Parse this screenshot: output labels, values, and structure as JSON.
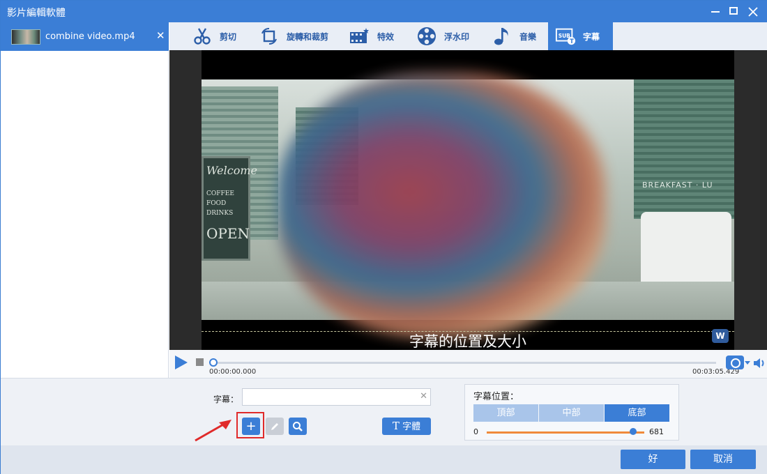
{
  "window": {
    "title": "影片編輯軟體"
  },
  "file_list": {
    "items": [
      {
        "name": "combine video.mp4",
        "close_glyph": "✕"
      }
    ]
  },
  "tabs": [
    {
      "label": "剪切",
      "icon": "scissors-icon",
      "active": false
    },
    {
      "label": "旋轉和裁剪",
      "icon": "rotate-crop-icon",
      "active": false
    },
    {
      "label": "特效",
      "icon": "effects-film-icon",
      "active": false
    },
    {
      "label": "浮水印",
      "icon": "watermark-film-reel-icon",
      "active": false
    },
    {
      "label": "音樂",
      "icon": "music-note-icon",
      "active": false
    },
    {
      "label": "字幕",
      "icon": "subtitle-icon",
      "active": true
    }
  ],
  "preview": {
    "subtitle_overlay": "字幕的位置及大小",
    "board_lines": [
      "Welcome",
      "COFFEE",
      "FOOD",
      "DRINKS",
      "OPEN"
    ],
    "shop_sign": "BREAKFAST · LU",
    "logo_text": "W"
  },
  "transport": {
    "current_time": "00:00:00.000",
    "total_time": "00:03:05.429",
    "progress_fraction": 0.0
  },
  "editor": {
    "subtitle_label": "字幕：",
    "subtitle_value": "",
    "clear_glyph": "✕",
    "add_glyph": "+",
    "font_button": "字體",
    "position": {
      "title": "字幕位置：",
      "options": [
        "頂部",
        "中部",
        "底部"
      ],
      "selected": "底部",
      "range_min": "0",
      "range_max": "681",
      "value_fraction": 0.93
    }
  },
  "footer": {
    "ok": "好",
    "cancel": "取消"
  },
  "colors": {
    "accent": "#3b7ed6",
    "highlight": "#e02a2a",
    "slider": "#f08a3a"
  }
}
